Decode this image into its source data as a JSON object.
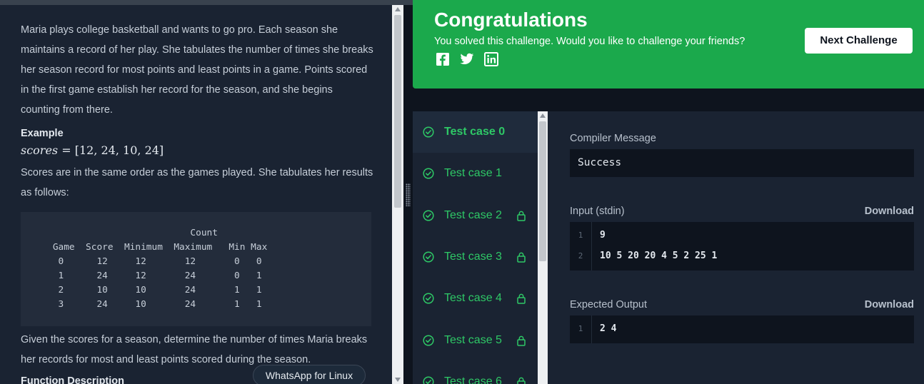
{
  "problem": {
    "intro": "Maria plays college basketball and wants to go pro. Each season she maintains a record of her play. She tabulates the number of times she breaks her season record for most points and least points in a game. Points scored in the first game establish her record for the season, and she begins counting from there.",
    "example_heading": "Example",
    "formula_var": "scores",
    "formula_value": "= [12, 24, 10, 24]",
    "order_text": "Scores are in the same order as the games played. She tabulates her results as follows:",
    "table_text": "                             Count\n    Game  Score  Minimum  Maximum   Min Max\n     0      12     12       12       0   0\n     1      24     12       24       0   1\n     2      10     10       24       1   1\n     3      24     10       24       1   1",
    "given_text": "Given the scores for a season, determine the number of times Maria breaks her records for most and least points scored during the season.",
    "function_heading": "Function Description"
  },
  "toast": "WhatsApp for Linux",
  "banner": {
    "title": "Congratulations",
    "subtitle": "You solved this challenge. Would you like to challenge your friends?",
    "next_button": "Next Challenge",
    "social_icons": [
      "facebook-icon",
      "twitter-icon",
      "linkedin-icon"
    ]
  },
  "test_cases": [
    {
      "label": "Test case 0",
      "locked": false,
      "active": true
    },
    {
      "label": "Test case 1",
      "locked": false,
      "active": false
    },
    {
      "label": "Test case 2",
      "locked": true,
      "active": false
    },
    {
      "label": "Test case 3",
      "locked": true,
      "active": false
    },
    {
      "label": "Test case 4",
      "locked": true,
      "active": false
    },
    {
      "label": "Test case 5",
      "locked": true,
      "active": false
    },
    {
      "label": "Test case 6",
      "locked": true,
      "active": false
    }
  ],
  "details": {
    "compiler_label": "Compiler Message",
    "compiler_message": "Success",
    "input_label": "Input (stdin)",
    "expected_label": "Expected Output",
    "download_label": "Download",
    "input_lines": [
      {
        "num": "1",
        "text": "9"
      },
      {
        "num": "2",
        "text": "10 5 20 20 4 5 2 25 1"
      }
    ],
    "output_lines": [
      {
        "num": "1",
        "text": "2 4"
      }
    ]
  },
  "colors": {
    "accent_green": "#1ba94c",
    "pass_green": "#2ec866",
    "panel_bg": "#1a2332",
    "page_bg": "#0e141e"
  }
}
